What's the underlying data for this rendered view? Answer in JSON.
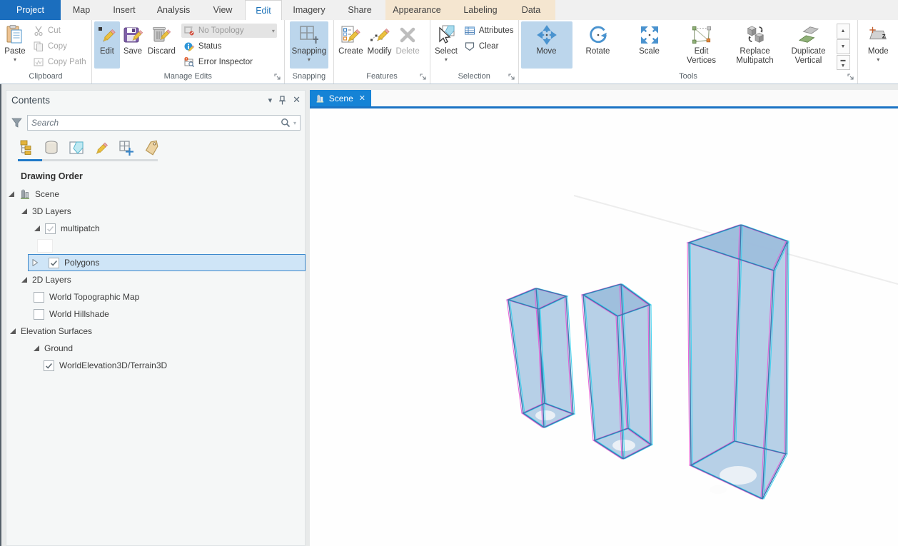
{
  "tabs": [
    {
      "label": "Project"
    },
    {
      "label": "Map"
    },
    {
      "label": "Insert"
    },
    {
      "label": "Analysis"
    },
    {
      "label": "View"
    },
    {
      "label": "Edit"
    },
    {
      "label": "Imagery"
    },
    {
      "label": "Share"
    },
    {
      "label": "Appearance"
    },
    {
      "label": "Labeling"
    },
    {
      "label": "Data"
    }
  ],
  "ribbon": {
    "clipboard": {
      "label": "Clipboard",
      "paste": "Paste",
      "cut": "Cut",
      "copy": "Copy",
      "copy_path": "Copy Path"
    },
    "manage_edits": {
      "label": "Manage Edits",
      "edit": "Edit",
      "save": "Save",
      "discard": "Discard",
      "topology": "No Topology",
      "status": "Status",
      "error_inspector": "Error Inspector"
    },
    "snapping": {
      "label": "Snapping",
      "button": "Snapping"
    },
    "features": {
      "label": "Features",
      "create": "Create",
      "modify": "Modify",
      "delete": "Delete"
    },
    "selection": {
      "label": "Selection",
      "select": "Select",
      "attributes": "Attributes",
      "clear": "Clear"
    },
    "tools": {
      "label": "Tools",
      "move": "Move",
      "rotate": "Rotate",
      "scale": "Scale",
      "edit_vertices": "Edit\nVertices",
      "replace_multipatch": "Replace\nMultipatch",
      "duplicate_vertical": "Duplicate\nVertical"
    },
    "mode": {
      "label": "Mode"
    }
  },
  "contents": {
    "title": "Contents",
    "search_placeholder": "Search",
    "heading": "Drawing Order",
    "tree": [
      {
        "label": "Scene"
      },
      {
        "label": "3D Layers"
      },
      {
        "label": "multipatch"
      },
      {
        "label": "Polygons"
      },
      {
        "label": "2D Layers"
      },
      {
        "label": "World Topographic Map"
      },
      {
        "label": "World Hillshade"
      },
      {
        "label": "Elevation Surfaces"
      },
      {
        "label": "Ground"
      },
      {
        "label": "WorldElevation3D/Terrain3D"
      }
    ]
  },
  "view": {
    "tab_label": "Scene"
  },
  "colors": {
    "accent_blue": "#1a73c4",
    "project_tab_blue": "#1b6ebe",
    "active_tab_text": "#1e73b8",
    "selected_button_bg": "#bcd6ec",
    "contextual_tab_bg": "#f5e6d0",
    "scene_tab_bg": "#1583d6",
    "tree_selection_bg": "#cfe5f7",
    "tree_selection_border": "#3c88cc",
    "box_fill": "#a7c6e2",
    "box_edge": "#3c76ad",
    "selection_magenta": "#e55ad5",
    "selection_cyan": "#37d2f0"
  }
}
